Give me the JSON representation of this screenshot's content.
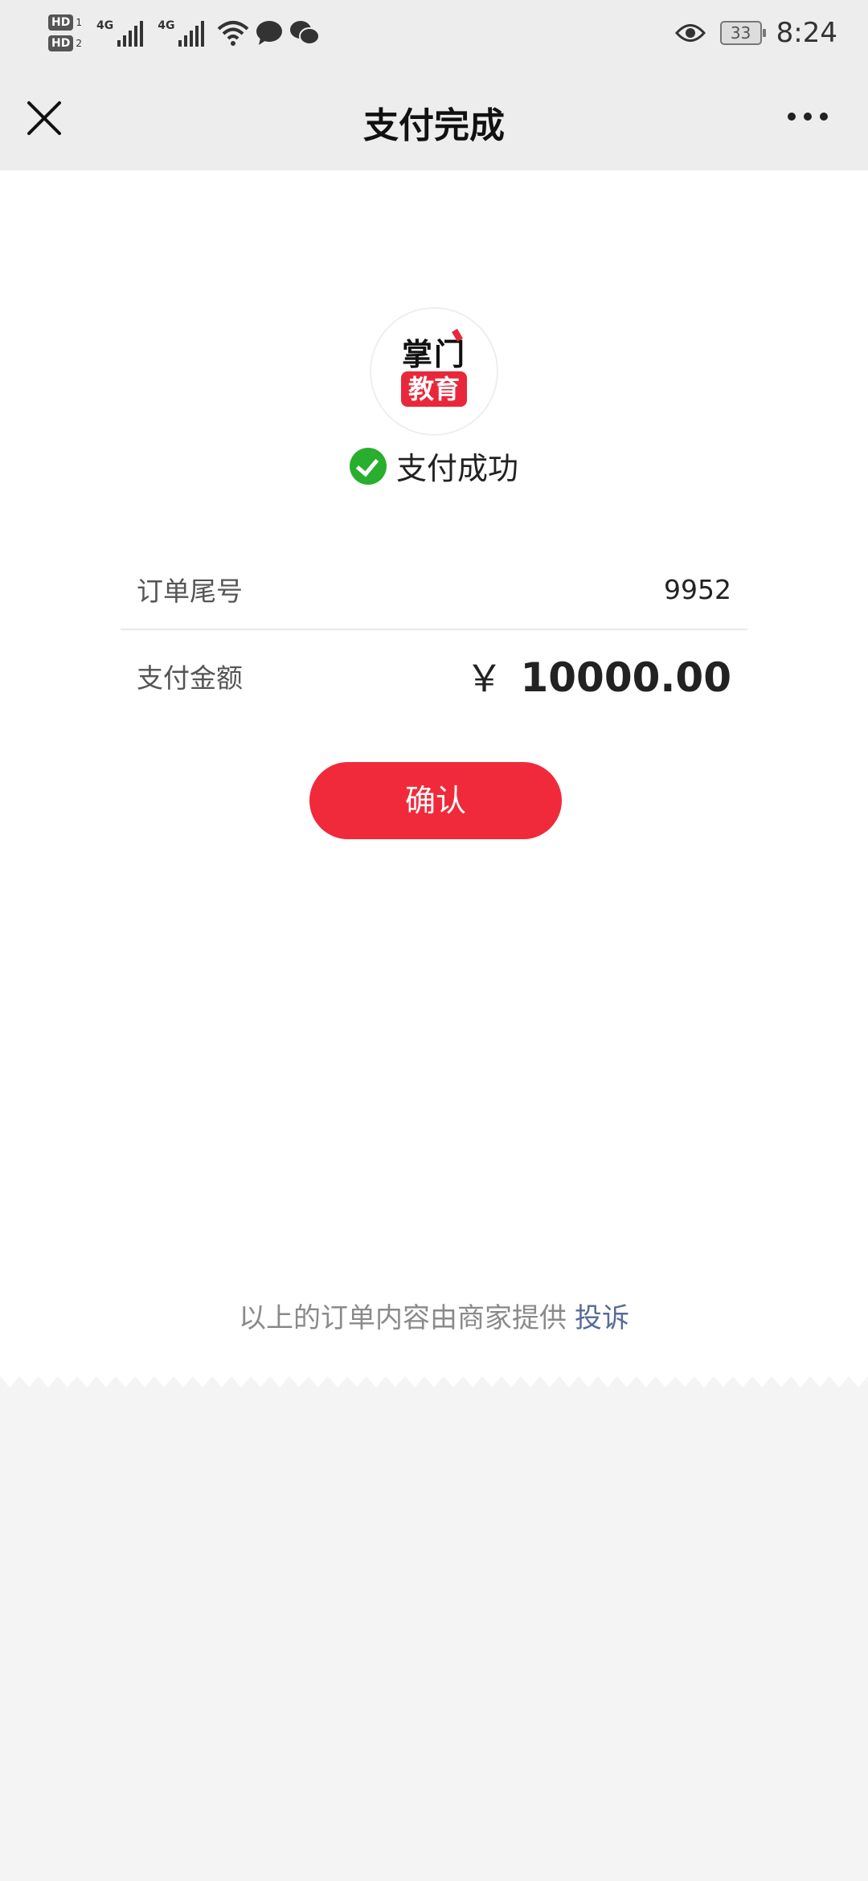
{
  "status_bar": {
    "sim1": "HD",
    "sim1_index": "1",
    "sim2": "HD",
    "sim2_index": "2",
    "net1": "4G",
    "net2": "4G",
    "battery": "33",
    "time": "8:24"
  },
  "nav": {
    "title": "支付完成"
  },
  "merchant": {
    "logo_line1": "掌门",
    "logo_line2": "教育"
  },
  "status": {
    "text": "支付成功"
  },
  "order": {
    "label": "订单尾号",
    "value": "9952"
  },
  "amount": {
    "label": "支付金额",
    "currency": "￥",
    "value": "10000.00"
  },
  "confirm": {
    "label": "确认"
  },
  "footer": {
    "text": "以上的订单内容由商家提供",
    "link": "投诉"
  },
  "colors": {
    "accent": "#f02a3a",
    "success": "#2aae2d",
    "link": "#576b95"
  }
}
